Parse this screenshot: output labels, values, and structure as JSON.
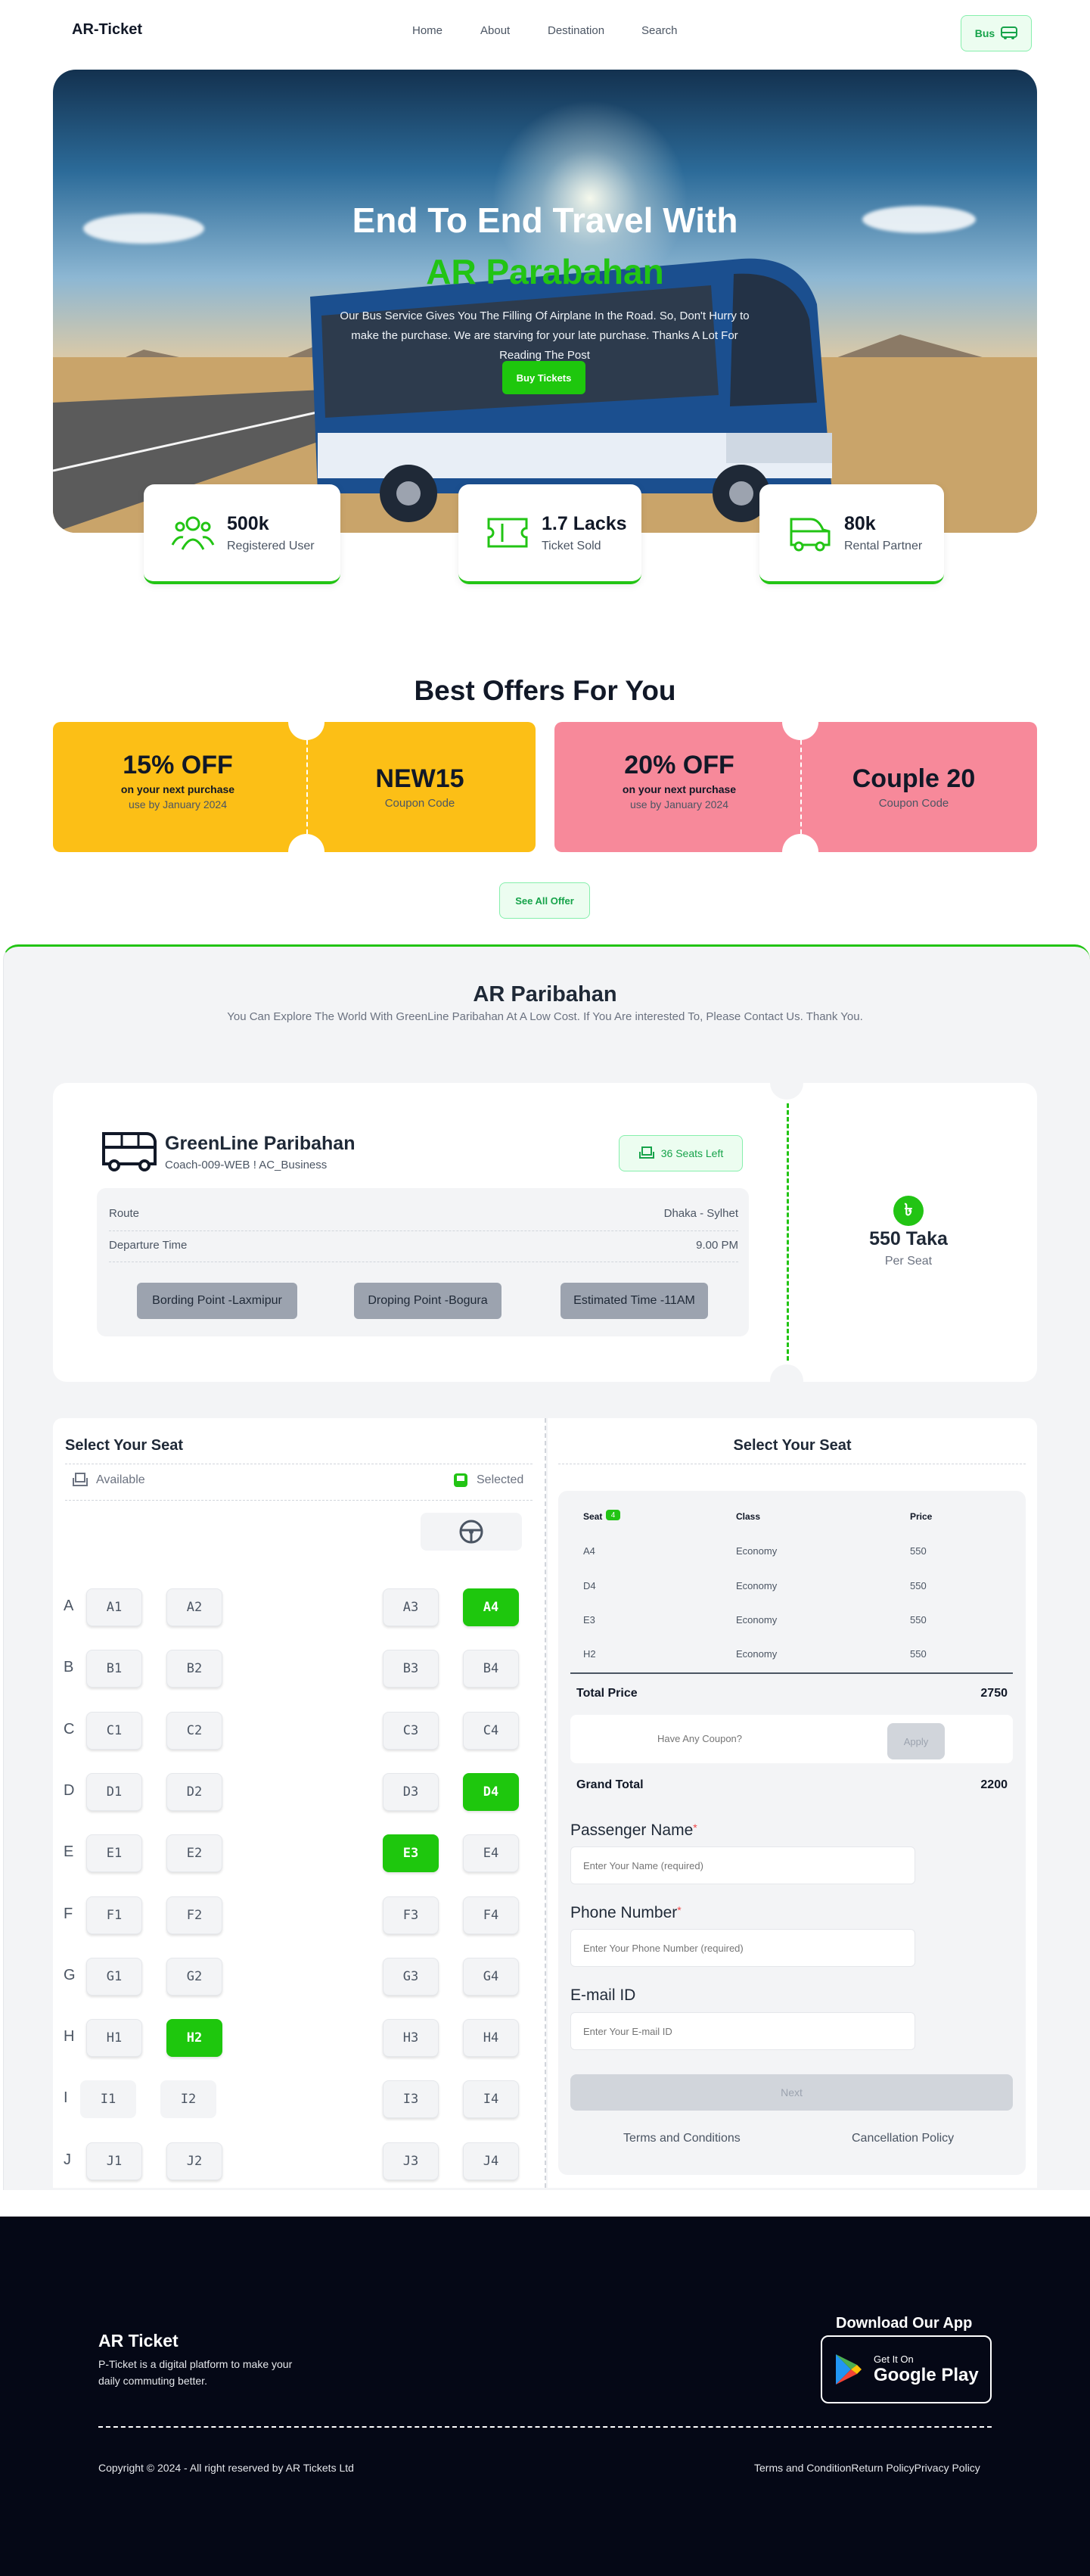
{
  "nav": {
    "logo": "AR-Ticket",
    "links": [
      "Home",
      "About",
      "Destination",
      "Search"
    ],
    "bus_button": "Bus"
  },
  "hero": {
    "title_line1": "End To End Travel With",
    "title_line2": "AR Parabahan",
    "description": "Our Bus Service Gives You The Filling Of Airplane In the Road. So, Don't Hurry to make the purchase. We are starving for your late purchase. Thanks A Lot For Reading The Post",
    "cta": "Buy Tickets"
  },
  "stats": [
    {
      "value": "500k",
      "label": "Registered User",
      "icon": "users-icon"
    },
    {
      "value": "1.7 Lacks",
      "label": "Ticket Sold",
      "icon": "ticket-icon"
    },
    {
      "value": "80k",
      "label": "Rental Partner",
      "icon": "bus-icon"
    }
  ],
  "offers": {
    "title": "Best Offers For You",
    "coupons": [
      {
        "percent": "15% OFF",
        "subtitle": "on your next purchase",
        "validity": "use by January 2024",
        "code": "NEW15",
        "code_label": "Coupon Code",
        "color": "#fcbf16"
      },
      {
        "percent": "20% OFF",
        "subtitle": "on your next purchase",
        "validity": "use by January 2024",
        "code": "Couple 20",
        "code_label": "Coupon Code",
        "color": "#f7899a"
      }
    ],
    "see_all": "See All Offer"
  },
  "booking": {
    "title": "AR Paribahan",
    "description": "You Can Explore The World With GreenLine Paribahan At A Low Cost. If You Are interested To, Please Contact Us. Thank You.",
    "operator": "GreenLine Paribahan",
    "coach": "Coach-009-WEB ! AC_Business",
    "seats_left": "36  Seats Left",
    "route_label": "Route",
    "route_value": "Dhaka - Sylhet",
    "departure_label": "Departure Time",
    "departure_value": "9.00 PM",
    "boarding": "Bording Point -Laxmipur",
    "dropping": "Droping Point -Bogura",
    "estimated": "Estimated Time -11AM",
    "taka_symbol": "৳",
    "price": "550 Taka",
    "per_seat": "Per Seat"
  },
  "seat_map": {
    "title": "Select Your Seat",
    "legend_available": "Available",
    "legend_selected": "Selected",
    "rows": [
      "A",
      "B",
      "C",
      "D",
      "E",
      "F",
      "G",
      "H",
      "I",
      "J"
    ],
    "seats": [
      [
        "A1",
        "A2",
        "A3",
        "A4"
      ],
      [
        "B1",
        "B2",
        "B3",
        "B4"
      ],
      [
        "C1",
        "C2",
        "C3",
        "C4"
      ],
      [
        "D1",
        "D2",
        "D3",
        "D4"
      ],
      [
        "E1",
        "E2",
        "E3",
        "E4"
      ],
      [
        "F1",
        "F2",
        "F3",
        "F4"
      ],
      [
        "G1",
        "G2",
        "G3",
        "G4"
      ],
      [
        "H1",
        "H2",
        "H3",
        "H4"
      ],
      [
        "I1",
        "I2",
        "I3",
        "I4"
      ],
      [
        "J1",
        "J2",
        "J3",
        "J4"
      ]
    ],
    "selected": [
      "A4",
      "D4",
      "E3",
      "H2"
    ],
    "accent": "#1ec70d"
  },
  "summary": {
    "title": "Select Your Seat",
    "headers": {
      "seat": "Seat",
      "class": "Class",
      "price": "Price"
    },
    "seat_count": "4",
    "rows": [
      {
        "seat": "A4",
        "class": "Economy",
        "price": "550"
      },
      {
        "seat": "D4",
        "class": "Economy",
        "price": "550"
      },
      {
        "seat": "E3",
        "class": "Economy",
        "price": "550"
      },
      {
        "seat": "H2",
        "class": "Economy",
        "price": "550"
      }
    ],
    "total_label": "Total Price",
    "total_value": "2750",
    "coupon_placeholder": "Have Any Coupon?",
    "apply": "Apply",
    "grand_label": "Grand Total",
    "grand_value": "2200",
    "name_label": "Passenger Name",
    "name_placeholder": "Enter Your Name (required)",
    "phone_label": "Phone Number",
    "phone_placeholder": "Enter Your Phone Number (required)",
    "email_label": "E-mail ID",
    "email_placeholder": "Enter Your E-mail ID",
    "required_mark": "*",
    "next": "Next",
    "terms": "Terms and Conditions",
    "cancellation": "Cancellation Policy"
  },
  "footer": {
    "title": "AR Ticket",
    "description": "P-Ticket is a digital platform to make your daily commuting better.",
    "download_title": "Download Our App",
    "gp_small": "Get It On",
    "gp_big": "Google Play",
    "copyright": "Copyright © 2024 - All right reserved by AR Tickets Ltd",
    "links": [
      "Terms and Condition",
      "Return Policy",
      "Privacy Policy"
    ]
  }
}
